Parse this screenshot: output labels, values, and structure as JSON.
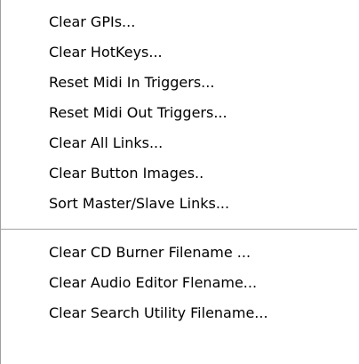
{
  "menu": {
    "group1": [
      {
        "label": "Clear GPIs..."
      },
      {
        "label": "Clear HotKeys..."
      },
      {
        "label": "Reset Midi In Triggers..."
      },
      {
        "label": "Reset Midi Out Triggers..."
      },
      {
        "label": "Clear All Links..."
      },
      {
        "label": "Clear Button Images.."
      },
      {
        "label": "Sort Master/Slave Links..."
      }
    ],
    "group2": [
      {
        "label": "Clear CD Burner Filename ..."
      },
      {
        "label": "Clear Audio Editor Flename..."
      },
      {
        "label": "Clear Search Utility Filename..."
      }
    ]
  }
}
